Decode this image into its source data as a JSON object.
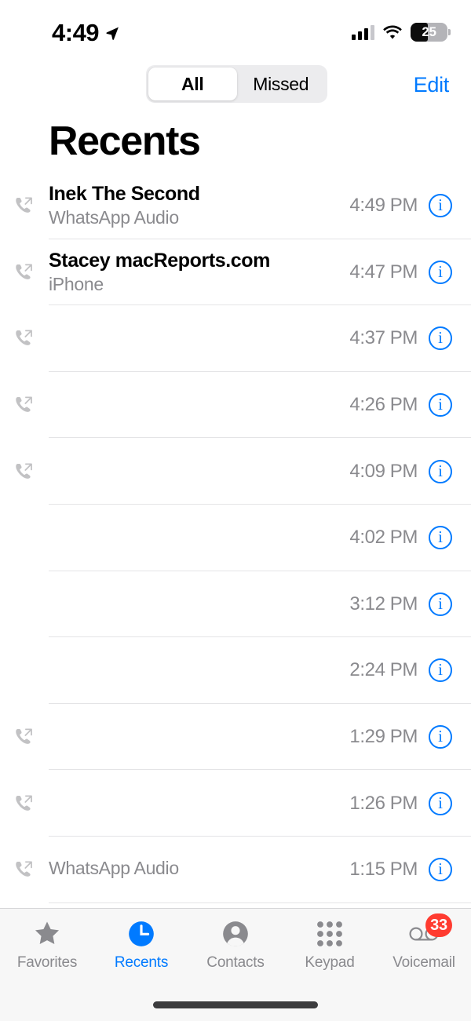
{
  "status_bar": {
    "time": "4:49",
    "location_arrow_icon": "location-arrow-icon",
    "cellular_icon": "cellular-bars-icon",
    "wifi_icon": "wifi-icon",
    "battery_level": "25",
    "battery_icon": "battery-icon"
  },
  "nav": {
    "segments": [
      {
        "label": "All",
        "selected": true
      },
      {
        "label": "Missed",
        "selected": false
      }
    ],
    "edit_label": "Edit"
  },
  "page_title": "Recents",
  "list": {
    "rows": [
      {
        "name": "Inek The Second",
        "subtitle": "WhatsApp Audio",
        "time": "4:49 PM",
        "call_icon": "outgoing-call-icon",
        "has_icon": true
      },
      {
        "name": "Stacey macReports.com",
        "subtitle": "iPhone",
        "time": "4:47 PM",
        "call_icon": "outgoing-call-icon",
        "has_icon": true
      },
      {
        "name": "",
        "subtitle": "",
        "time": "4:37 PM",
        "call_icon": "outgoing-call-icon",
        "has_icon": true
      },
      {
        "name": "",
        "subtitle": "",
        "time": "4:26 PM",
        "call_icon": "outgoing-call-icon",
        "has_icon": true
      },
      {
        "name": "",
        "subtitle": "",
        "time": "4:09 PM",
        "call_icon": "outgoing-call-icon",
        "has_icon": true
      },
      {
        "name": "",
        "subtitle": "",
        "time": "4:02 PM",
        "call_icon": "",
        "has_icon": false
      },
      {
        "name": "",
        "subtitle": "",
        "time": "3:12 PM",
        "call_icon": "",
        "has_icon": false
      },
      {
        "name": "",
        "subtitle": "",
        "time": "2:24 PM",
        "call_icon": "",
        "has_icon": false
      },
      {
        "name": "",
        "subtitle": "",
        "time": "1:29 PM",
        "call_icon": "outgoing-call-icon",
        "has_icon": true
      },
      {
        "name": "",
        "subtitle": "",
        "time": "1:26 PM",
        "call_icon": "outgoing-call-icon",
        "has_icon": true
      },
      {
        "name": "",
        "subtitle": "WhatsApp Audio",
        "time": "1:15 PM",
        "call_icon": "outgoing-call-icon",
        "has_icon": true
      }
    ],
    "info_glyph": "i"
  },
  "tab_bar": {
    "items": [
      {
        "label": "Favorites",
        "icon": "star-icon",
        "active": false,
        "badge": ""
      },
      {
        "label": "Recents",
        "icon": "clock-icon",
        "active": true,
        "badge": ""
      },
      {
        "label": "Contacts",
        "icon": "person-circle-icon",
        "active": false,
        "badge": ""
      },
      {
        "label": "Keypad",
        "icon": "keypad-grid-icon",
        "active": false,
        "badge": ""
      },
      {
        "label": "Voicemail",
        "icon": "voicemail-icon",
        "active": false,
        "badge": "33"
      }
    ]
  },
  "colors": {
    "accent_blue": "#007aff",
    "badge_red": "#ff3b30",
    "secondary_text": "#8a8a8e",
    "separator": "#e4e4e6",
    "tab_bar_bg": "#f7f7f7"
  }
}
